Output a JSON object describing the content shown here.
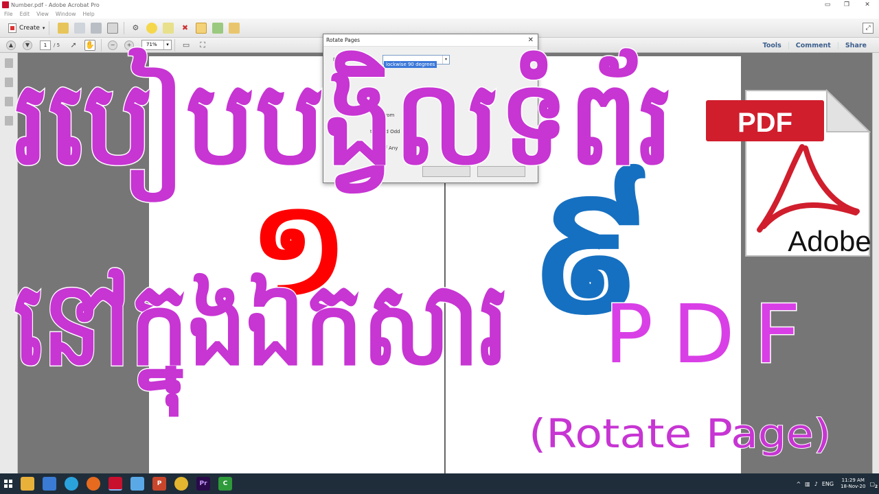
{
  "window": {
    "title": "Number.pdf - Adobe Acrobat Pro",
    "controls": [
      "▭",
      "❐",
      "✕"
    ]
  },
  "menu": [
    "File",
    "Edit",
    "View",
    "Window",
    "Help"
  ],
  "toolbar": {
    "create_label": "Create",
    "icons": [
      "open-folder-icon",
      "save-icon",
      "print-icon",
      "email-icon",
      "gear-icon",
      "comment-icon",
      "highlight-icon",
      "delete-icon",
      "select-icon",
      "export-icon",
      "edit-icon"
    ]
  },
  "nav": {
    "page_current": "1",
    "page_total": "/ 5",
    "zoom": "71%",
    "links": [
      "Tools",
      "Comment",
      "Share"
    ]
  },
  "dialog": {
    "title": "Rotate Pages",
    "close": "✕",
    "direction_label": "Di",
    "direction_value": "lockwise 90 degrees",
    "from_label": "From",
    "row2_label": "nd Odd",
    "row3_label": "of Any",
    "row2_prefix": "te:"
  },
  "overlay": {
    "line1": "របៀបបង្វិលទំព័រ",
    "line2": "នៅក្នុងឯកសារ",
    "pdf_word": "PDF",
    "subtitle": "(Rotate Page)"
  },
  "logo": {
    "badge_text": "PDF",
    "brand_text": "Adobe"
  },
  "page_numerals": {
    "left": "១",
    "right": "៩"
  },
  "colors": {
    "overlay_fill": "#c735d3",
    "numeral_red": "#ff0000",
    "numeral_blue": "#1670c1",
    "logo_red": "#d01e2d"
  },
  "taskbar": {
    "apps": [
      "file-explorer-icon",
      "edge-icon",
      "telegram-icon",
      "firefox-icon",
      "acrobat-icon",
      "notes-icon",
      "powerpoint-icon",
      "chrome-icon",
      "premiere-icon",
      "camtasia-icon"
    ],
    "app_labels": [
      "",
      "",
      "",
      "",
      "",
      "",
      "P",
      "",
      "Pr",
      "C"
    ],
    "lang": "ENG",
    "time": "11:29 AM",
    "date": "18-Nov-20",
    "notifications": "2"
  }
}
